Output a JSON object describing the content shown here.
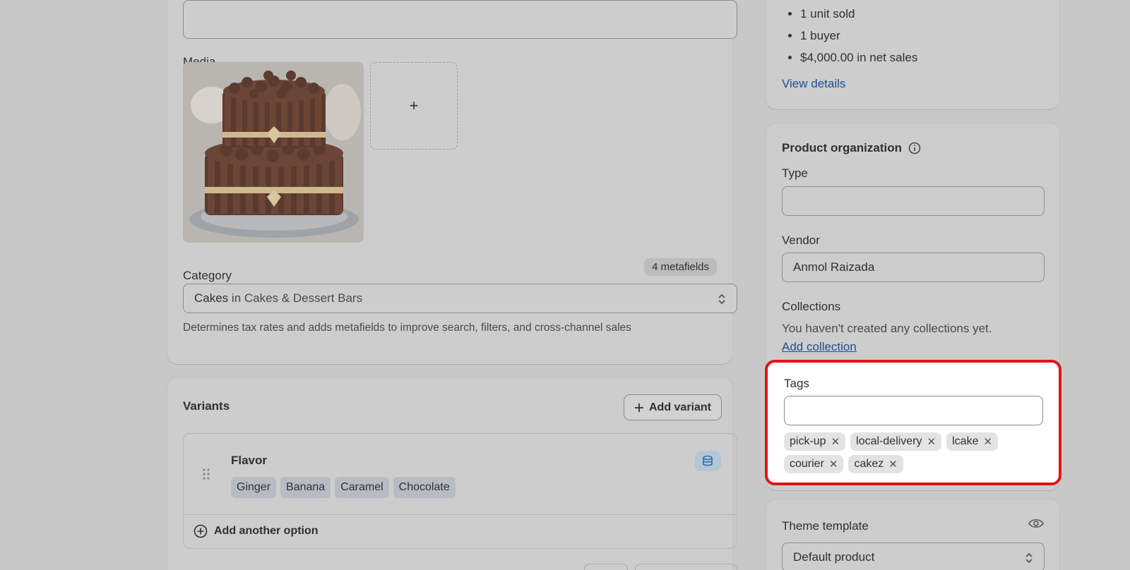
{
  "media": {
    "label": "Media",
    "add_symbol": "+"
  },
  "category": {
    "label": "Category",
    "metafields_badge": "4 metafields",
    "selected_primary": "Cakes",
    "selected_secondary": "in Cakes & Dessert Bars",
    "help_text": "Determines tax rates and adds metafields to improve search, filters, and cross-channel sales"
  },
  "variants": {
    "title": "Variants",
    "add_variant_label": "Add variant",
    "option_name": "Flavor",
    "option_values": [
      "Ginger",
      "Banana",
      "Caramel",
      "Chocolate"
    ],
    "add_another_label": "Add another option"
  },
  "insights": {
    "items": [
      "1 unit sold",
      "1 buyer",
      "$4,000.00 in net sales"
    ],
    "view_details_label": "View details"
  },
  "product_organization": {
    "title": "Product organization",
    "type_label": "Type",
    "type_value": "",
    "vendor_label": "Vendor",
    "vendor_value": "Anmol Raizada",
    "collections_label": "Collections",
    "collections_empty": "You haven't created any collections yet.",
    "add_collection_label": "Add collection"
  },
  "tags": {
    "label": "Tags",
    "input_value": "",
    "items": [
      "pick-up",
      "local-delivery",
      "lcake",
      "courier",
      "cakez"
    ],
    "highlight_color": "#e0141a"
  },
  "theme_template": {
    "label": "Theme template",
    "selected": "Default product"
  },
  "colors": {
    "link": "#1d4f91",
    "overlay_background": "#c8c8c8"
  }
}
